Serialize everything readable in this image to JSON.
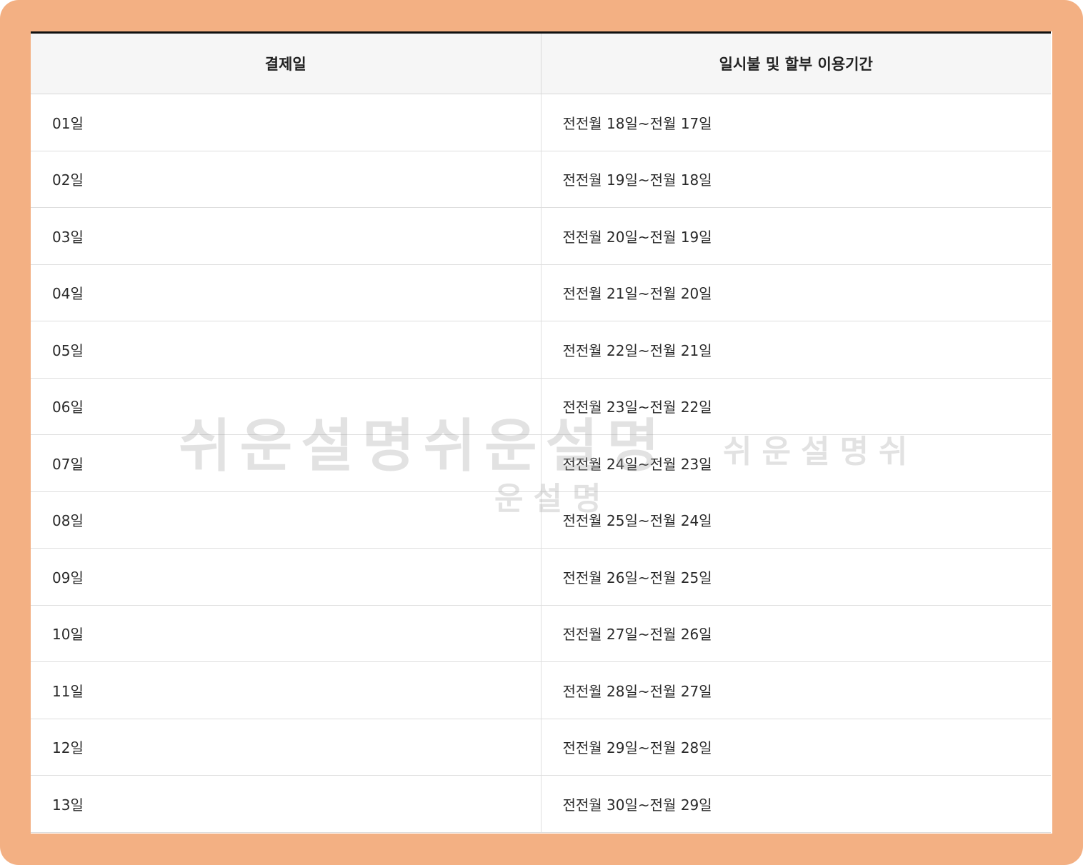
{
  "table": {
    "headers": [
      "결제일",
      "일시불 및 할부 이용기간"
    ],
    "rows": [
      [
        "01일",
        "전전월 18일~전월 17일"
      ],
      [
        "02일",
        "전전월 19일~전월 18일"
      ],
      [
        "03일",
        "전전월 20일~전월 19일"
      ],
      [
        "04일",
        "전전월 21일~전월 20일"
      ],
      [
        "05일",
        "전전월 22일~전월 21일"
      ],
      [
        "06일",
        "전전월 23일~전월 22일"
      ],
      [
        "07일",
        "전전월 24일~전월 23일"
      ],
      [
        "08일",
        "전전월 25일~전월 24일"
      ],
      [
        "09일",
        "전전월 26일~전월 25일"
      ],
      [
        "10일",
        "전전월 27일~전월 26일"
      ],
      [
        "11일",
        "전전월 28일~전월 27일"
      ],
      [
        "12일",
        "전전월 29일~전월 28일"
      ],
      [
        "13일",
        "전전월 30일~전월 29일"
      ]
    ]
  },
  "watermark": {
    "main": "쉬운설명쉬운설명",
    "side": "쉬운설명쉬",
    "sub": "운설명"
  },
  "colors": {
    "frame": "#f3b083",
    "header_bg": "#f6f6f6",
    "top_rule": "#111111"
  }
}
